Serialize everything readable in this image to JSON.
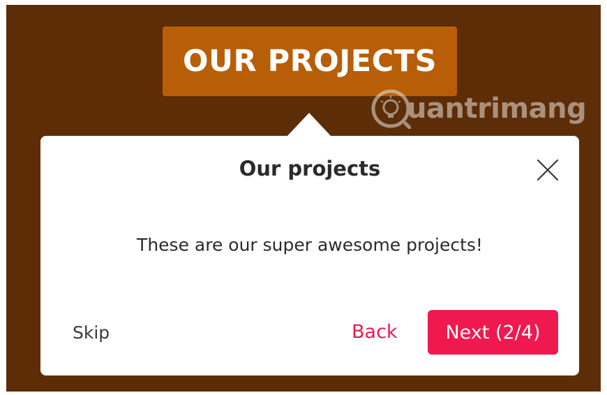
{
  "header": {
    "title": "OUR PROJECTS"
  },
  "watermark": {
    "text": "uantrimang",
    "icon": "lightbulb-logo-icon"
  },
  "tour": {
    "title": "Our projects",
    "body": "These are our super awesome projects!",
    "close_icon": "close-icon",
    "skip_label": "Skip",
    "back_label": "Back",
    "next_label": "Next (2/4)"
  },
  "colors": {
    "background": "#5c2d07",
    "header_badge": "#b85e08",
    "accent": "#f0194f",
    "card": "#ffffff"
  }
}
